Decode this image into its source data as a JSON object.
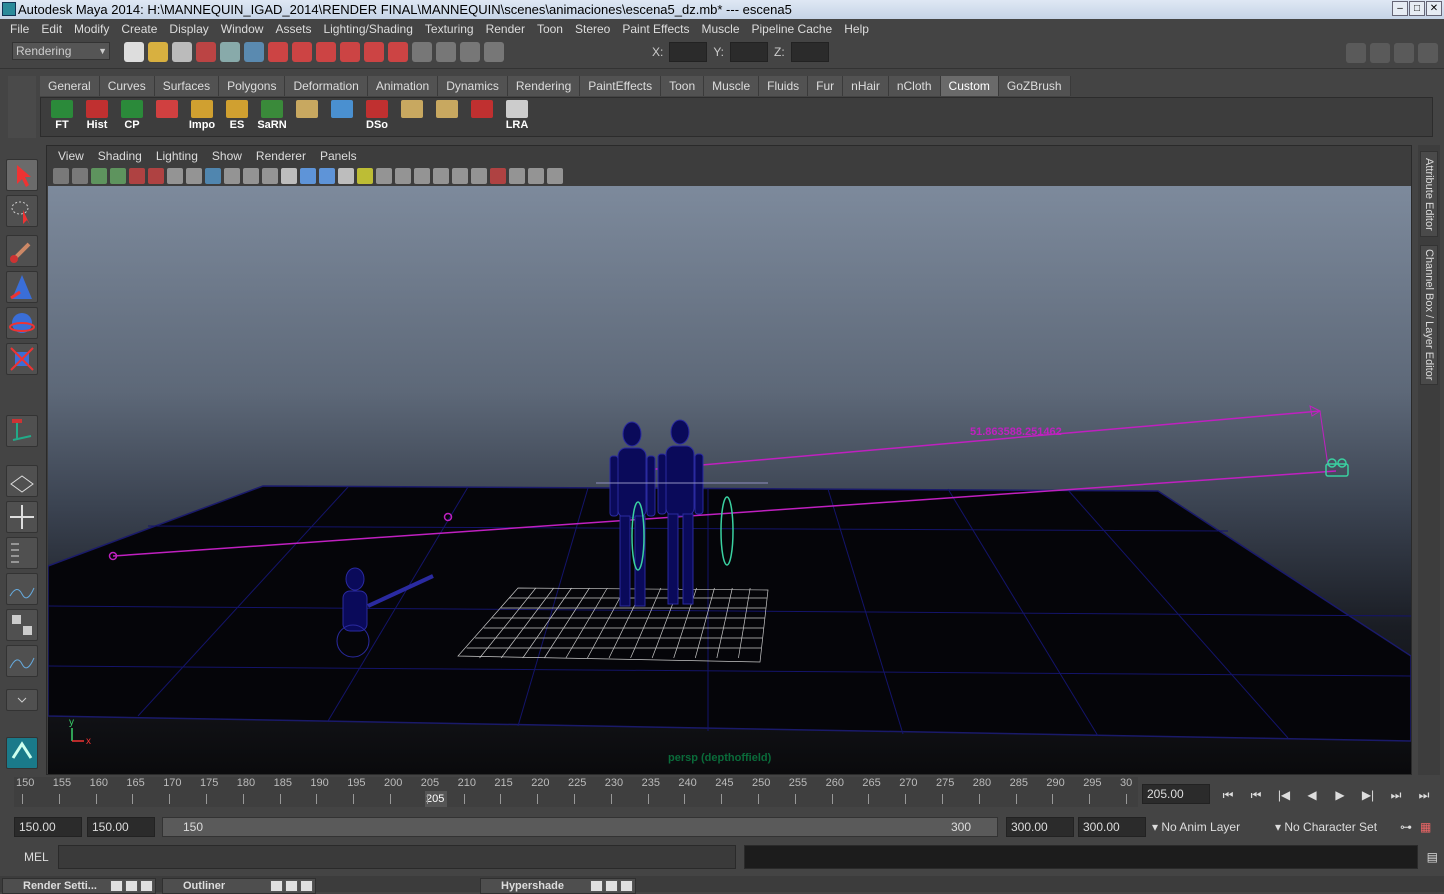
{
  "window": {
    "title": "Autodesk Maya 2014: H:\\MANNEQUIN_IGAD_2014\\RENDER FINAL\\MANNEQUIN\\scenes\\animaciones\\escena5_dz.mb*   ---   escena5",
    "minimize": "–",
    "maximize": "□",
    "close": "✕"
  },
  "menu": [
    "File",
    "Edit",
    "Modify",
    "Create",
    "Display",
    "Window",
    "Assets",
    "Lighting/Shading",
    "Texturing",
    "Render",
    "Toon",
    "Stereo",
    "Paint Effects",
    "Muscle",
    "Pipeline Cache",
    "Help"
  ],
  "status": {
    "mode": "Rendering",
    "x_label": "X:",
    "y_label": "Y:",
    "z_label": "Z:"
  },
  "shelf_tabs": [
    "General",
    "Curves",
    "Surfaces",
    "Polygons",
    "Deformation",
    "Animation",
    "Dynamics",
    "Rendering",
    "PaintEffects",
    "Toon",
    "Muscle",
    "Fluids",
    "Fur",
    "nHair",
    "nCloth",
    "Custom",
    "GoZBrush"
  ],
  "shelf_active": "Custom",
  "shelf_buttons": [
    {
      "label": "FT",
      "icon": "ft-icon",
      "color": "#2b8a3a"
    },
    {
      "label": "Hist",
      "icon": "history-icon",
      "color": "#c03030"
    },
    {
      "label": "CP",
      "icon": "cp-icon",
      "color": "#2b8a3a"
    },
    {
      "label": "",
      "icon": "cone-icon",
      "color": "#d04040"
    },
    {
      "label": "Impo",
      "icon": "folder-icon",
      "color": "#d0a030"
    },
    {
      "label": "ES",
      "icon": "folder-icon",
      "color": "#d0a030"
    },
    {
      "label": "SaRN",
      "icon": "sarn-icon",
      "color": "#3a8a3a"
    },
    {
      "label": "",
      "icon": "plane-icon",
      "color": "#c8a860"
    },
    {
      "label": "",
      "icon": "t-icon",
      "color": "#4a90d0"
    },
    {
      "label": "DSo",
      "icon": "dso-icon",
      "color": "#c03030"
    },
    {
      "label": "",
      "icon": "plane-icon",
      "color": "#c8a860"
    },
    {
      "label": "",
      "icon": "plane-icon",
      "color": "#c8a860"
    },
    {
      "label": "",
      "icon": "joint-icon",
      "color": "#c03030"
    },
    {
      "label": "LRA",
      "icon": "eye-icon",
      "color": "#cccccc"
    }
  ],
  "panel_menu": [
    "View",
    "Shading",
    "Lighting",
    "Show",
    "Renderer",
    "Panels"
  ],
  "viewport": {
    "camera": "persp (depthoffield)",
    "distance_label": "51.863588.251462",
    "axis_x": "x",
    "axis_y": "y"
  },
  "side_tabs": [
    "Attribute Editor",
    "Channel Box / Layer Editor"
  ],
  "timeline": {
    "ticks": [
      "150",
      "155",
      "160",
      "165",
      "170",
      "175",
      "180",
      "185",
      "190",
      "195",
      "200",
      "205",
      "210",
      "215",
      "220",
      "225",
      "230",
      "235",
      "240",
      "245",
      "250",
      "255",
      "260",
      "265",
      "270",
      "275",
      "280",
      "285",
      "290",
      "295",
      "30"
    ],
    "current_frame": "205",
    "current_field": "205.00"
  },
  "playback": [
    "⏮",
    "⏮",
    "|◀",
    "◀",
    "▶",
    "▶|",
    "⏭",
    "⏭"
  ],
  "range": {
    "start_field": "150.00",
    "start_inner": "150.00",
    "slider_start": "150",
    "slider_end": "300",
    "end_inner": "300.00",
    "end_field": "300.00",
    "anim_layer": "No Anim Layer",
    "char_set": "No Character Set"
  },
  "cmd": {
    "label": "MEL"
  },
  "taskbar": [
    {
      "label": "Render Setti..."
    },
    {
      "label": "Outliner"
    },
    {
      "label": "Hypershade"
    }
  ]
}
